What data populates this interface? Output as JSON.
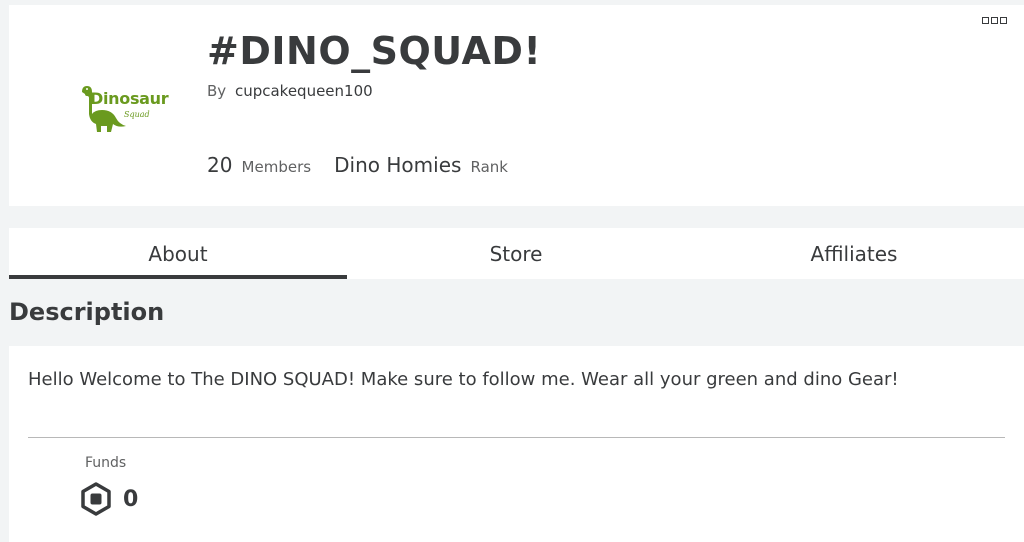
{
  "group": {
    "title": "#DINO_SQUAD!",
    "by_label": "By",
    "owner": "cupcakequeen100",
    "emblem": {
      "word": "Dinosaur",
      "sub": "Squad",
      "color": "#6a9a1f"
    },
    "members_count": "20",
    "members_label": "Members",
    "rank_name": "Dino Homies",
    "rank_label": "Rank"
  },
  "tabs": [
    {
      "label": "About",
      "active": true
    },
    {
      "label": "Store",
      "active": false
    },
    {
      "label": "Affiliates",
      "active": false
    }
  ],
  "description": {
    "heading": "Description",
    "text": "Hello Welcome to The DINO SQUAD! Make sure to follow me. Wear all your green and dino Gear!"
  },
  "funds": {
    "label": "Funds",
    "value": "0",
    "icon": "robux-icon"
  },
  "colors": {
    "text": "#393b3d",
    "muted": "#606162",
    "background": "#f2f4f5",
    "card": "#ffffff"
  }
}
